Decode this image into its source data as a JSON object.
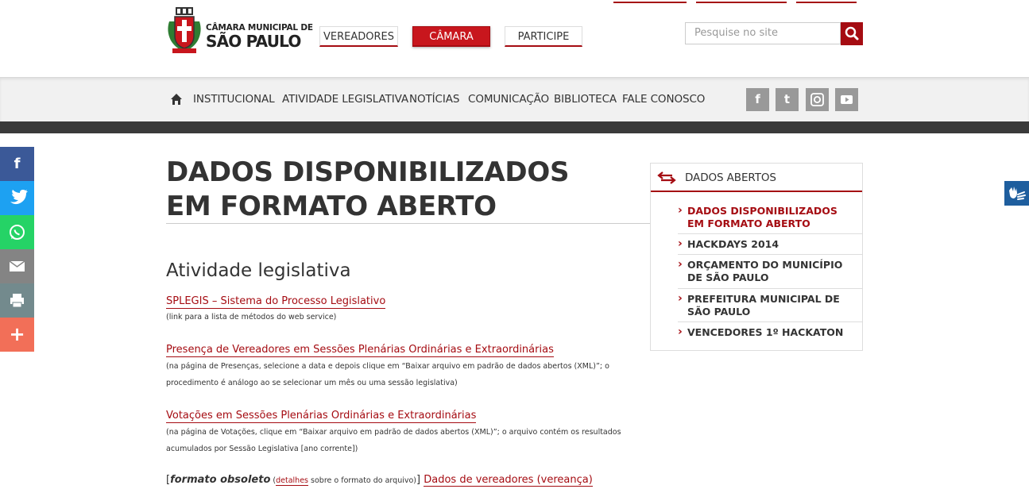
{
  "header": {
    "logo_line1": "CÂMARA MUNICIPAL DE",
    "logo_line2": "SÃO PAULO",
    "nav": [
      "VEREADORES",
      "CÂMARA",
      "PARTICIPE"
    ],
    "search_placeholder": "Pesquise no site",
    "accent_color": "#a50c12"
  },
  "subnav": {
    "items": [
      "INSTITUCIONAL",
      "ATIVIDADE LEGISLATIVA",
      "NOTÍCIAS",
      "COMUNICAÇÃO",
      "BIBLIOTECA",
      "FALE CONOSCO"
    ],
    "social": [
      "facebook-icon",
      "twitter-icon",
      "instagram-icon",
      "youtube-icon"
    ]
  },
  "share": {
    "buttons": [
      {
        "icon": "facebook-icon",
        "glyph": "f",
        "color": "#3b5998"
      },
      {
        "icon": "twitter-icon",
        "glyph": "t",
        "color": "#1da1f2"
      },
      {
        "icon": "whatsapp-icon",
        "glyph": "✆",
        "color": "#25d366"
      },
      {
        "icon": "email-icon",
        "glyph": "✉",
        "color": "#848484"
      },
      {
        "icon": "print-icon",
        "glyph": "⎙",
        "color": "#738a8d"
      },
      {
        "icon": "more-icon",
        "glyph": "+",
        "color": "#f26f58"
      }
    ]
  },
  "main": {
    "title": "DADOS DISPONIBILIZADOS EM FORMATO ABERTO",
    "section": "Atividade legislativa",
    "entries": [
      {
        "link": "SPLEGIS – Sistema do Processo Legislativo",
        "note": "(link para a lista de métodos do web service)"
      },
      {
        "link": "Presença de Vereadores em Sessões Plenárias Ordinárias e Extraordinárias",
        "note": "(na página de Presenças, selecione a data e depois clique em “Baixar arquivo em padrão de dados abertos (XML)”; o procedimento é análogo ao se selecionar um mês ou uma sessão legislativa)"
      },
      {
        "link": "Votações em Sessões Plenárias Ordinárias e Extraordinárias",
        "note": "(na página de Votações, clique em “Baixar arquivo em padrão de dados abertos (XML)”; o arquivo contém os resultados acumulados por Sessão Legislativa [ano corrente])"
      }
    ],
    "obsolete": {
      "open": "[",
      "label": "formato obsoleto",
      "paren_open": " (",
      "details": "detalhes",
      "details_rest": " sobre o formato do arquivo)",
      "close": "] ",
      "link": "Dados de vereadores (vereança)"
    }
  },
  "sidebar": {
    "title": "DADOS ABERTOS",
    "items": [
      "DADOS DISPONIBILIZADOS EM FORMATO ABERTO",
      "HACKDAYS 2014",
      "ORÇAMENTO DO MUNICÍPIO DE SÃO PAULO",
      "PREFEITURA MUNICIPAL DE SÃO PAULO",
      "VENCEDORES 1º HACKATON"
    ]
  }
}
